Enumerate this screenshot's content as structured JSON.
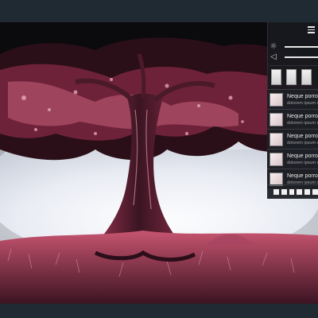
{
  "menu": {
    "icon": "hamburger-menu-icon"
  },
  "controls": {
    "brightness_icon": "☼",
    "brightness_level": 1.0,
    "volume_icon": "◁",
    "volume_level": 1.0
  },
  "thumbnails": [
    {},
    {},
    {}
  ],
  "list": {
    "items": [
      {
        "title": "Neque porro q",
        "subtitle": "dolorem ipsum qui"
      },
      {
        "title": "Neque porro q",
        "subtitle": "dolorem ipsum qui"
      },
      {
        "title": "Neque porro q",
        "subtitle": "dolorem ipsum qui"
      },
      {
        "title": "Neque porro q",
        "subtitle": "dolorem ipsum qui"
      },
      {
        "title": "Neque porro q",
        "subtitle": "dolorem ipsum qui"
      }
    ]
  },
  "pager": {
    "count": 6
  },
  "colors": {
    "frame": "#1f2a33",
    "sky": "#eef0f6",
    "foliage": "#8a2a44",
    "highlight": "#e9a2b4",
    "panel": "#181a1f"
  }
}
